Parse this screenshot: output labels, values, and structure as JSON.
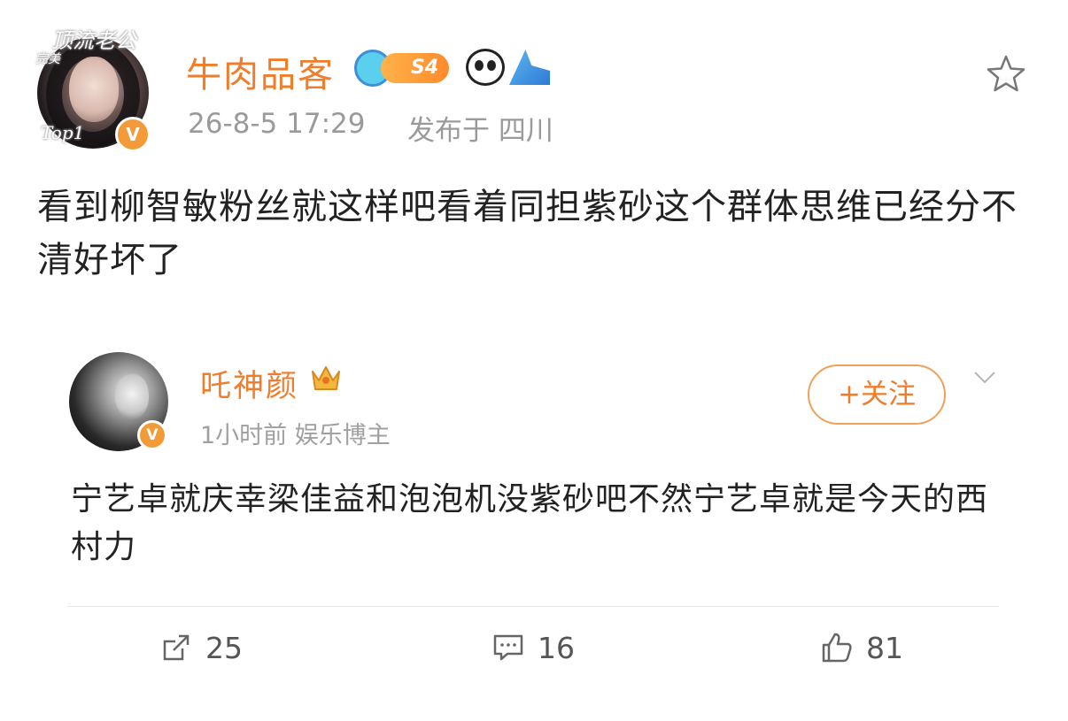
{
  "post": {
    "avatar_deco_top": "顶流老公",
    "avatar_deco_left": "完美",
    "avatar_deco_bottom": "Top1",
    "verified_mark": "V",
    "author": "牛肉品客",
    "level_badge": "S4",
    "timestamp": "26-8-5 17:29",
    "location": "发布于 四川",
    "text": "看到柳智敏粉丝就这样吧看着同担紫砂这个群体思维已经分不清好坏了"
  },
  "repost": {
    "author": "吒神颜",
    "verified_mark": "V",
    "meta": "1小时前  娱乐博主",
    "follow_label": "+关注",
    "text": "宁艺卓就庆幸梁佳益和泡泡机没紫砂吧不然宁艺卓就是今天的西村力"
  },
  "actions": {
    "repost_count": "25",
    "comment_count": "16",
    "like_count": "81"
  },
  "colors": {
    "accent": "#ef7d2c",
    "verified": "#f29b38",
    "meta": "#9a9a9a"
  },
  "icons": [
    "star-icon",
    "crown-icon",
    "chevron-down-icon",
    "repost-icon",
    "comment-icon",
    "like-icon"
  ]
}
